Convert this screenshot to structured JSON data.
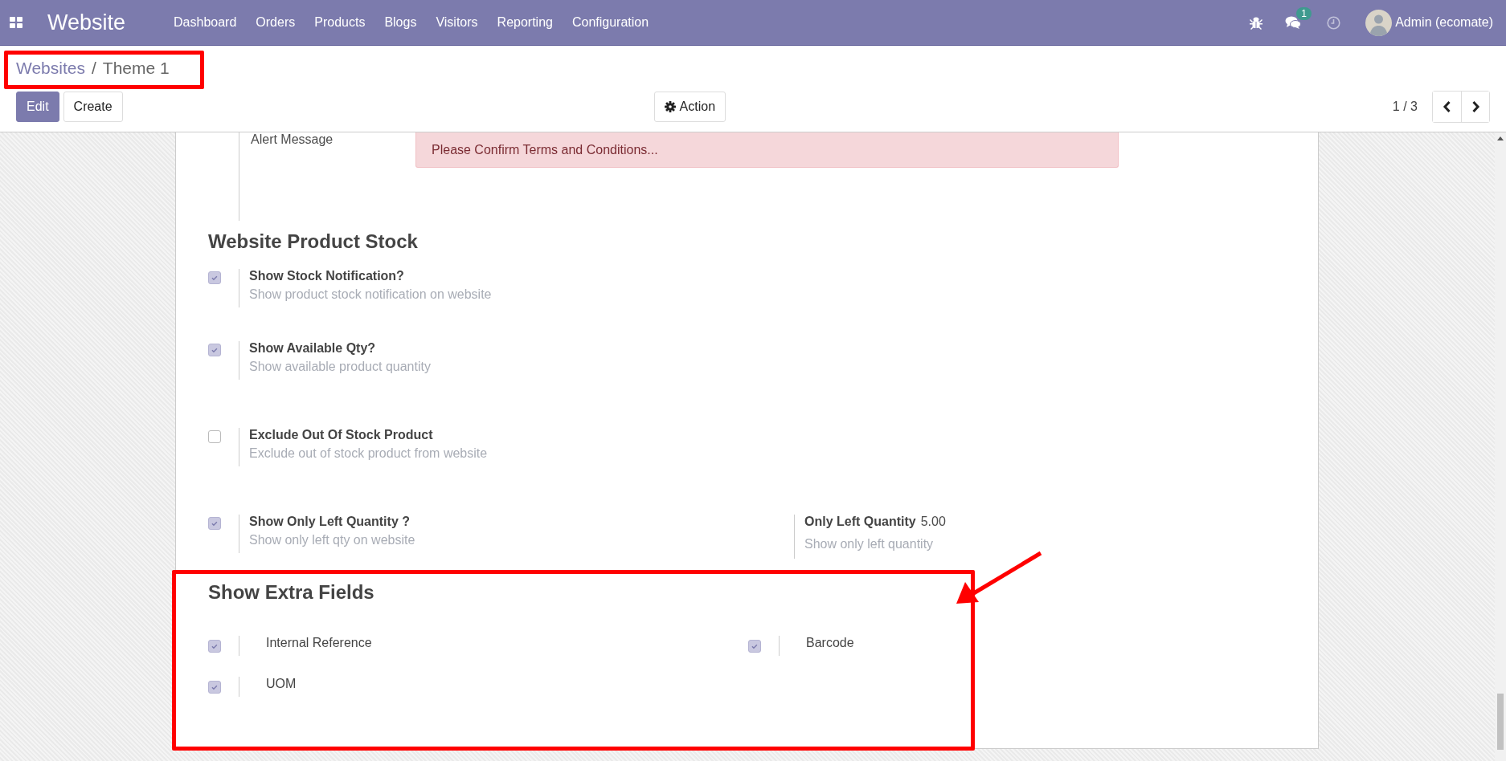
{
  "navbar": {
    "app_title": "Website",
    "menu": [
      "Dashboard",
      "Orders",
      "Products",
      "Blogs",
      "Visitors",
      "Reporting",
      "Configuration"
    ],
    "messages_badge": "1",
    "user": "Admin (ecomate)"
  },
  "breadcrumb": {
    "parent": "Websites",
    "separator": "/",
    "current": "Theme 1"
  },
  "buttons": {
    "edit": "Edit",
    "create": "Create",
    "action": "Action"
  },
  "pager": "1 / 3",
  "alert_field": {
    "label": "Alert Message",
    "value": "Please Confirm Terms and Conditions..."
  },
  "stock_section": {
    "title": "Website Product Stock",
    "rows": [
      {
        "checked": true,
        "title": "Show Stock Notification?",
        "description": "Show product stock notification on website"
      },
      {
        "checked": true,
        "title": "Show Available Qty?",
        "description": "Show available product quantity"
      },
      {
        "checked": false,
        "title": "Exclude Out Of Stock Product",
        "description": "Exclude out of stock product from website"
      },
      {
        "checked": true,
        "title": "Show Only Left Quantity ?",
        "description": "Show only left qty on website",
        "side": {
          "label": "Only Left Quantity",
          "value": "5.00",
          "description": "Show only left quantity"
        }
      }
    ]
  },
  "extra_section": {
    "title": "Show Extra Fields",
    "items": [
      {
        "checked": true,
        "label": "Internal Reference"
      },
      {
        "checked": true,
        "label": "Barcode"
      },
      {
        "checked": true,
        "label": "UOM"
      }
    ]
  }
}
